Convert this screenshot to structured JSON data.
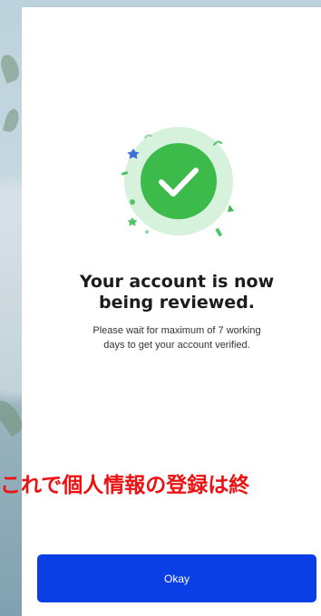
{
  "colors": {
    "accent_green": "#3cba4a",
    "ring_light_green": "#d7f2dc",
    "button_blue": "#0b3fe6",
    "caption_red": "#ee1111"
  },
  "success_icon": "check-circle-icon",
  "review": {
    "title_line1": "Your account is now",
    "title_line2": "being reviewed.",
    "subtitle_line1": "Please wait for maximum of 7 working",
    "subtitle_line2": "days to get your account verified."
  },
  "overlay_caption": "これで個人情報の登録は終",
  "okay_button": {
    "label": "Okay"
  }
}
